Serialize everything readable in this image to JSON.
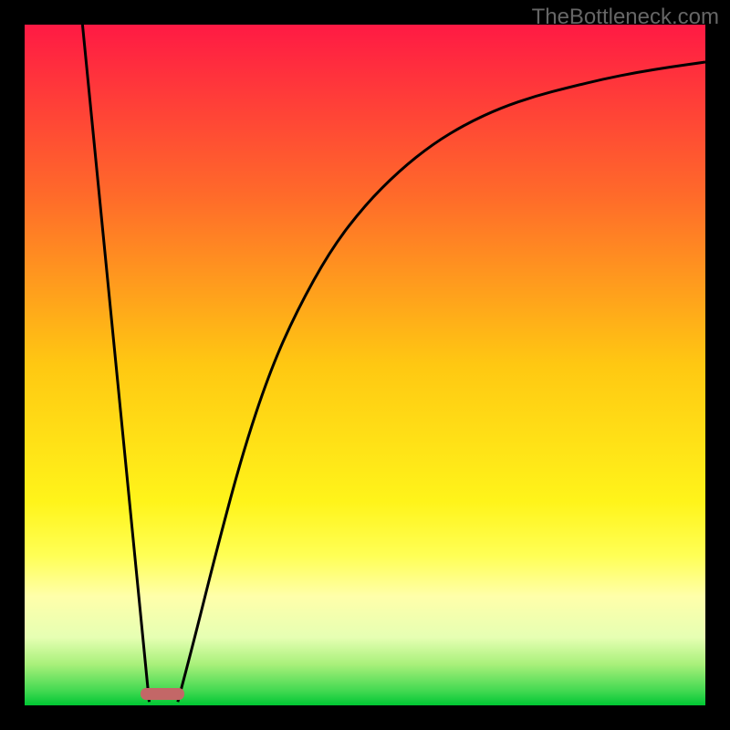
{
  "watermark": "TheBottleneck.com",
  "chart_data": {
    "type": "line",
    "title": "",
    "xlabel": "",
    "ylabel": "",
    "xlim": [
      0,
      100
    ],
    "ylim": [
      0,
      100
    ],
    "gradient_stops": [
      {
        "offset": 0,
        "color": "#ff1a44"
      },
      {
        "offset": 25,
        "color": "#ff6a2a"
      },
      {
        "offset": 50,
        "color": "#ffc812"
      },
      {
        "offset": 70,
        "color": "#fff41a"
      },
      {
        "offset": 78,
        "color": "#ffff55"
      },
      {
        "offset": 84,
        "color": "#ffffaa"
      },
      {
        "offset": 90,
        "color": "#e6ffb3"
      },
      {
        "offset": 94,
        "color": "#a8f07a"
      },
      {
        "offset": 98,
        "color": "#3fd850"
      },
      {
        "offset": 100,
        "color": "#00c733"
      }
    ],
    "series": [
      {
        "name": "left-line",
        "type": "segment",
        "points": [
          {
            "x": 8.5,
            "y": 100
          },
          {
            "x": 18.3,
            "y": 0.5
          }
        ]
      },
      {
        "name": "right-curve",
        "type": "curve",
        "points": [
          {
            "x": 22.5,
            "y": 0.5
          },
          {
            "x": 25,
            "y": 10
          },
          {
            "x": 28,
            "y": 22
          },
          {
            "x": 32,
            "y": 37
          },
          {
            "x": 36,
            "y": 49
          },
          {
            "x": 40,
            "y": 58
          },
          {
            "x": 45,
            "y": 67
          },
          {
            "x": 50,
            "y": 73.5
          },
          {
            "x": 55,
            "y": 78.5
          },
          {
            "x": 60,
            "y": 82.5
          },
          {
            "x": 65,
            "y": 85.5
          },
          {
            "x": 70,
            "y": 87.8
          },
          {
            "x": 75,
            "y": 89.5
          },
          {
            "x": 80,
            "y": 90.8
          },
          {
            "x": 85,
            "y": 92
          },
          {
            "x": 90,
            "y": 93
          },
          {
            "x": 95,
            "y": 93.8
          },
          {
            "x": 100,
            "y": 94.5
          }
        ]
      }
    ],
    "marker": {
      "x_center_pct": 20.3,
      "y_bottom_pct": 99.2,
      "color": "#c36767"
    }
  }
}
